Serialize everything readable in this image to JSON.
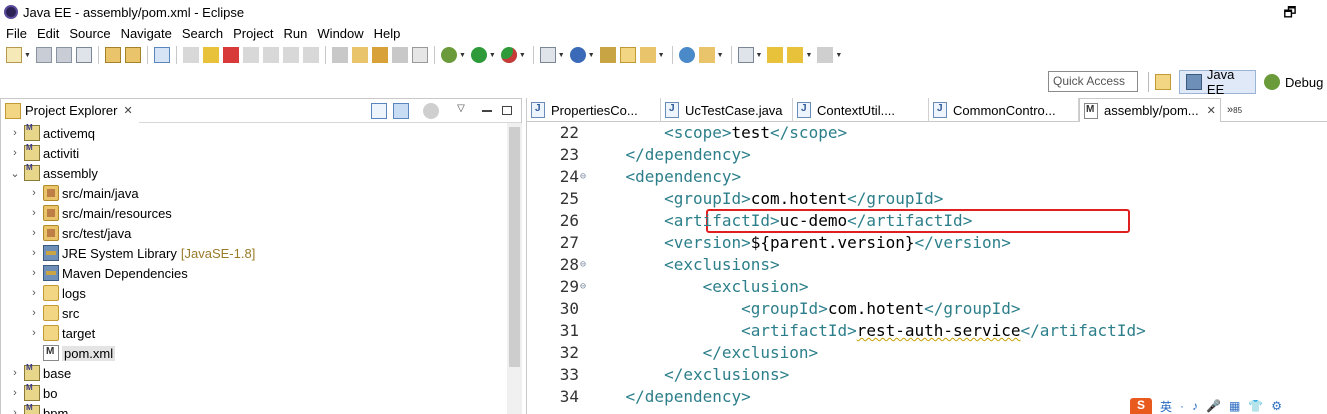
{
  "window": {
    "title": "Java EE - assembly/pom.xml - Eclipse",
    "restore_glyph": "🗗"
  },
  "menu": [
    "File",
    "Edit",
    "Source",
    "Navigate",
    "Search",
    "Project",
    "Run",
    "Window",
    "Help"
  ],
  "toolbar": {
    "quick_access_placeholder": "Quick Access",
    "perspectives": [
      {
        "label": "Java EE",
        "active": true
      },
      {
        "label": "Debug",
        "active": false
      }
    ]
  },
  "explorer": {
    "tab_label": "Project Explorer",
    "close_glyph": "✕",
    "tree": [
      {
        "label": "activemq",
        "icon": "project-icon",
        "expanded": false,
        "depth": 0
      },
      {
        "label": "activiti",
        "icon": "project-icon",
        "expanded": false,
        "depth": 0
      },
      {
        "label": "assembly",
        "icon": "project-icon",
        "expanded": true,
        "depth": 0
      },
      {
        "label": "src/main/java",
        "icon": "source-folder-icon",
        "expanded": false,
        "depth": 1
      },
      {
        "label": "src/main/resources",
        "icon": "source-folder-icon",
        "expanded": false,
        "depth": 1
      },
      {
        "label": "src/test/java",
        "icon": "source-folder-icon",
        "expanded": false,
        "depth": 1
      },
      {
        "label": "JRE System Library",
        "decoration": "[JavaSE-1.8]",
        "icon": "library-icon",
        "expanded": false,
        "depth": 1
      },
      {
        "label": "Maven Dependencies",
        "icon": "library-icon",
        "expanded": false,
        "depth": 1
      },
      {
        "label": "logs",
        "icon": "folder-icon",
        "expanded": false,
        "depth": 1
      },
      {
        "label": "src",
        "icon": "folder-icon",
        "expanded": false,
        "depth": 1
      },
      {
        "label": "target",
        "icon": "folder-icon",
        "expanded": false,
        "depth": 1
      },
      {
        "label": "pom.xml",
        "icon": "xml-file-icon",
        "expanded": null,
        "depth": 1,
        "selected": true
      },
      {
        "label": "base",
        "icon": "project-icon",
        "expanded": false,
        "depth": 0
      },
      {
        "label": "bo",
        "icon": "project-icon",
        "expanded": false,
        "depth": 0
      },
      {
        "label": "bpm",
        "icon": "project-icon",
        "expanded": false,
        "depth": 0
      }
    ]
  },
  "editor": {
    "tabs": [
      {
        "label": "PropertiesCo...",
        "type": "java"
      },
      {
        "label": "UcTestCase.java",
        "type": "java"
      },
      {
        "label": "ContextUtil....",
        "type": "java"
      },
      {
        "label": "CommonContro...",
        "type": "java"
      },
      {
        "label": "assembly/pom...",
        "type": "xml",
        "active": true
      }
    ],
    "more_tabs": "»",
    "more_tabs_count": "85",
    "lines": [
      {
        "num": "22",
        "fold": "",
        "indent": "        ",
        "open": "<scope>",
        "content": "test",
        "close": "</scope>"
      },
      {
        "num": "23",
        "fold": "",
        "indent": "    ",
        "open": "</dependency>",
        "content": "",
        "close": ""
      },
      {
        "num": "24",
        "fold": "⊖",
        "indent": "    ",
        "open": "<dependency>",
        "content": "",
        "close": ""
      },
      {
        "num": "25",
        "fold": "",
        "indent": "        ",
        "open": "<groupId>",
        "content": "com.hotent",
        "close": "</groupId>"
      },
      {
        "num": "26",
        "fold": "",
        "indent": "        ",
        "open": "<artifactId>",
        "content": "uc-demo",
        "close": "</artifactId>",
        "highlighted": true
      },
      {
        "num": "27",
        "fold": "",
        "indent": "        ",
        "open": "<version>",
        "content": "${parent.version}",
        "close": "</version>"
      },
      {
        "num": "28",
        "fold": "⊖",
        "indent": "        ",
        "open": "<exclusions>",
        "content": "",
        "close": ""
      },
      {
        "num": "29",
        "fold": "⊖",
        "indent": "            ",
        "open": "<exclusion>",
        "content": "",
        "close": ""
      },
      {
        "num": "30",
        "fold": "",
        "indent": "                ",
        "open": "<groupId>",
        "content": "com.hotent",
        "close": "</groupId>"
      },
      {
        "num": "31",
        "fold": "",
        "indent": "                ",
        "open": "<artifactId>",
        "content": "rest-auth-service",
        "close": "</artifactId>",
        "squiggle": true
      },
      {
        "num": "32",
        "fold": "",
        "indent": "            ",
        "open": "</exclusion>",
        "content": "",
        "close": ""
      },
      {
        "num": "33",
        "fold": "",
        "indent": "        ",
        "open": "</exclusions>",
        "content": "",
        "close": ""
      },
      {
        "num": "34",
        "fold": "",
        "indent": "    ",
        "open": "</dependency>",
        "content": "",
        "close": ""
      }
    ]
  },
  "ime": {
    "logo": "S",
    "items": [
      "英",
      "·",
      "♪",
      "🎤",
      "▦",
      "👕",
      "⚙"
    ]
  },
  "colors": {
    "xml_tag": "#2c7f8a",
    "highlight_box": "#e02020",
    "active_perspective": "#dfe9f7"
  }
}
